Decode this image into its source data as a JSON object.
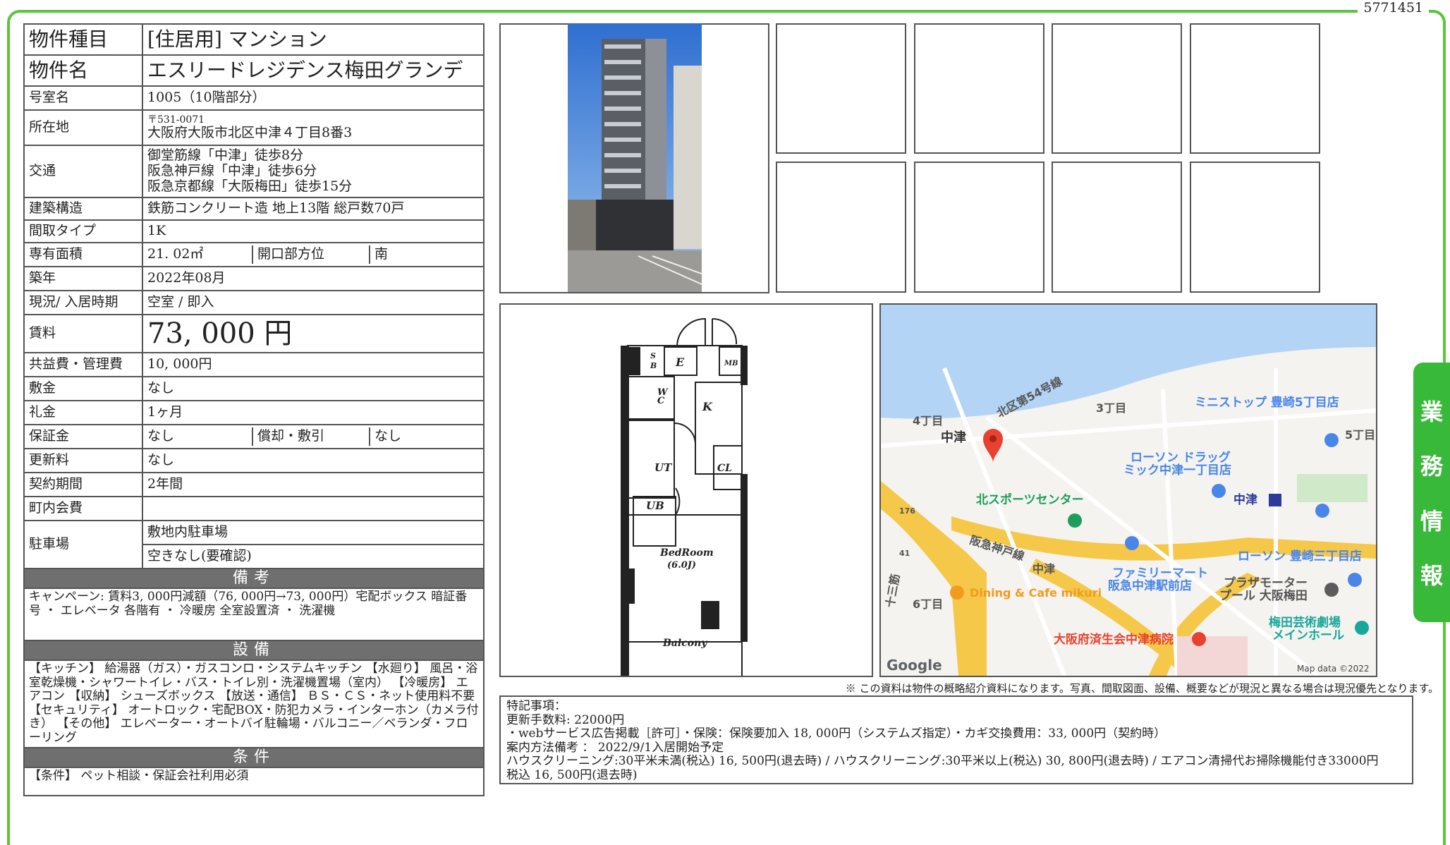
{
  "doc_id": "5771451",
  "side_tab": [
    "業",
    "務",
    "情",
    "報"
  ],
  "property": {
    "type_label": "物件種目",
    "type_value": "[住居用] マンション",
    "name_label": "物件名",
    "name_value": "エスリードレジデンス梅田グランデ",
    "room_label": "号室名",
    "room_value": "1005（10階部分）",
    "address_label": "所在地",
    "postal": "〒531-0071",
    "address": "大阪府大阪市北区中津４丁目8番3",
    "transit_label": "交通",
    "transit": [
      "御堂筋線「中津」徒歩8分",
      "阪急神戸線「中津」徒歩6分",
      "阪急京都線「大阪梅田」徒歩15分"
    ],
    "structure_label": "建築構造",
    "structure_value": "鉄筋コンクリート造 地上13階 総戸数70戸",
    "layout_label": "間取タイプ",
    "layout_value": "1K",
    "area_label": "専有面積",
    "area_value": "21. 02㎡",
    "direction_label": "開口部方位",
    "direction_value": "南",
    "built_label": "築年",
    "built_value": "2022年08月",
    "status_label": "現況/ 入居時期",
    "status_value": "空室 / 即入",
    "rent_label": "賃料",
    "rent_value": "73, 000 円",
    "fee_label": "共益費・管理費",
    "fee_value": "10, 000円",
    "deposit_label": "敷金",
    "deposit_value": "なし",
    "keymoney_label": "礼金",
    "keymoney_value": "1ヶ月",
    "guarantee_label": "保証金",
    "guarantee_value": "なし",
    "amort_label": "償却・敷引",
    "amort_value": "なし",
    "renewal_label": "更新料",
    "renewal_value": "なし",
    "contract_label": "契約期間",
    "contract_value": "2年間",
    "community_label": "町内会費",
    "community_value": "",
    "parking_label": "駐車場",
    "parking_value1": "敷地内駐車場",
    "parking_value2": "空きなし(要確認)"
  },
  "remarks": {
    "header": "備考",
    "text": "キャンペーン: 賃料3, 000円減額（76, 000円→73, 000円）宅配ボックス 暗証番号 ・ エレベータ 各階有 ・ 冷暖房 全室設置済 ・ 洗濯機"
  },
  "equipment": {
    "header": "設備",
    "text": "【キッチン】 給湯器（ガス）・ガスコンロ・システムキッチン 【水廻り】 風呂・浴室乾燥機・シャワートイレ・バス・トイレ別・洗濯機置場（室内） 【冷暖房】 エアコン 【収納】 シューズボックス 【放送・通信】 ＢＳ・ＣＳ・ネット使用料不要 【セキュリティ】 オートロック・宅配BOX・防犯カメラ・インターホン（カメラ付き） 【その他】 エレベーター・オートバイ駐輪場・バルコニー／ベランダ・フローリング"
  },
  "conditions": {
    "header": "条件",
    "text": "【条件】 ペット相談・保証会社利用必須"
  },
  "floorplan": {
    "sb": "S\nB",
    "e": "E",
    "mb": "MB",
    "wc": "W\nC",
    "k": "K",
    "ut": "UT",
    "ub": "UB",
    "cl": "CL",
    "bedroom": "BedRoom",
    "bedroom_size": "(6.0J)",
    "balcony": "Balcony"
  },
  "map": {
    "labels": [
      "北区第54号線",
      "3丁目",
      "4丁目",
      "中津",
      "ミニストップ 豊崎5丁目店",
      "5丁目",
      "ローソン ドラッグ",
      "ミック中津一丁目店",
      "北スポーツセンター",
      "中津",
      "阪急神戸線",
      "中津",
      "ファミリーマート",
      "阪急中津駅前店",
      "ローソン 豊崎三丁目店",
      "プラザモーター",
      "プール 大阪梅田",
      "十三筋",
      "6丁目",
      "Dining & Cafe mikuri",
      "梅田芸術劇場",
      "メインホール",
      "大阪府済生会中津病院",
      "176",
      "41"
    ],
    "google": "Google",
    "credit": "Map data ©2022",
    "colors": {
      "water": "#b3d4f5",
      "land": "#f4f3ef",
      "highway": "#f5c84a",
      "pin": "#e8412f"
    }
  },
  "disclaimer": "※ この資料は物件の概略紹介資料になります。写真、間取図面、設備、概要などが現況と異なる場合は現況優先となります。",
  "special_notes": [
    "特記事項：",
    "更新手数料: 22000円",
    "・webサービス広告掲載［許可］・保険：保険要加入 18, 000円（システムズ指定）・カギ交換費用：33, 000円（契約時）",
    "案内方法備考 ： 2022/9/1入居開始予定",
    "ハウスクリーニング:30平米未満(税込) 16, 500円(退去時) / ハウスクリーニング:30平米以上(税込) 30, 800円(退去時) / エアコン清掃代お掃除機能付き33000円",
    "税込 16, 500円(退去時)"
  ]
}
